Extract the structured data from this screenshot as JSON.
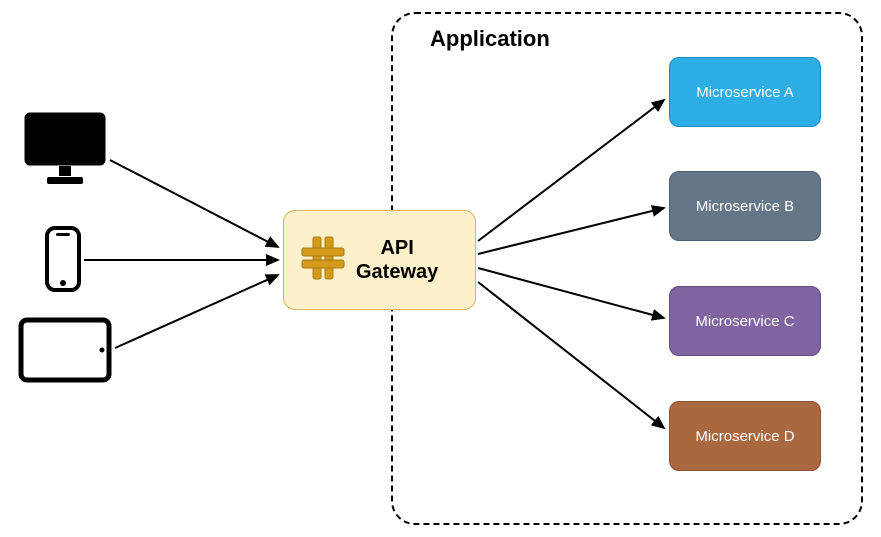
{
  "application": {
    "title": "Application"
  },
  "gateway": {
    "label_line1": "API",
    "label_line2": "Gateway"
  },
  "services": {
    "a": {
      "label": "Microservice A",
      "color": "#2cade4"
    },
    "b": {
      "label": "Microservice B",
      "color": "#647687"
    },
    "c": {
      "label": "Microservice C",
      "color": "#8064a2"
    },
    "d": {
      "label": "Microservice D",
      "color": "#aa6840"
    }
  },
  "clients": {
    "desktop": "desktop-monitor",
    "phone": "smartphone",
    "tablet": "tablet"
  }
}
